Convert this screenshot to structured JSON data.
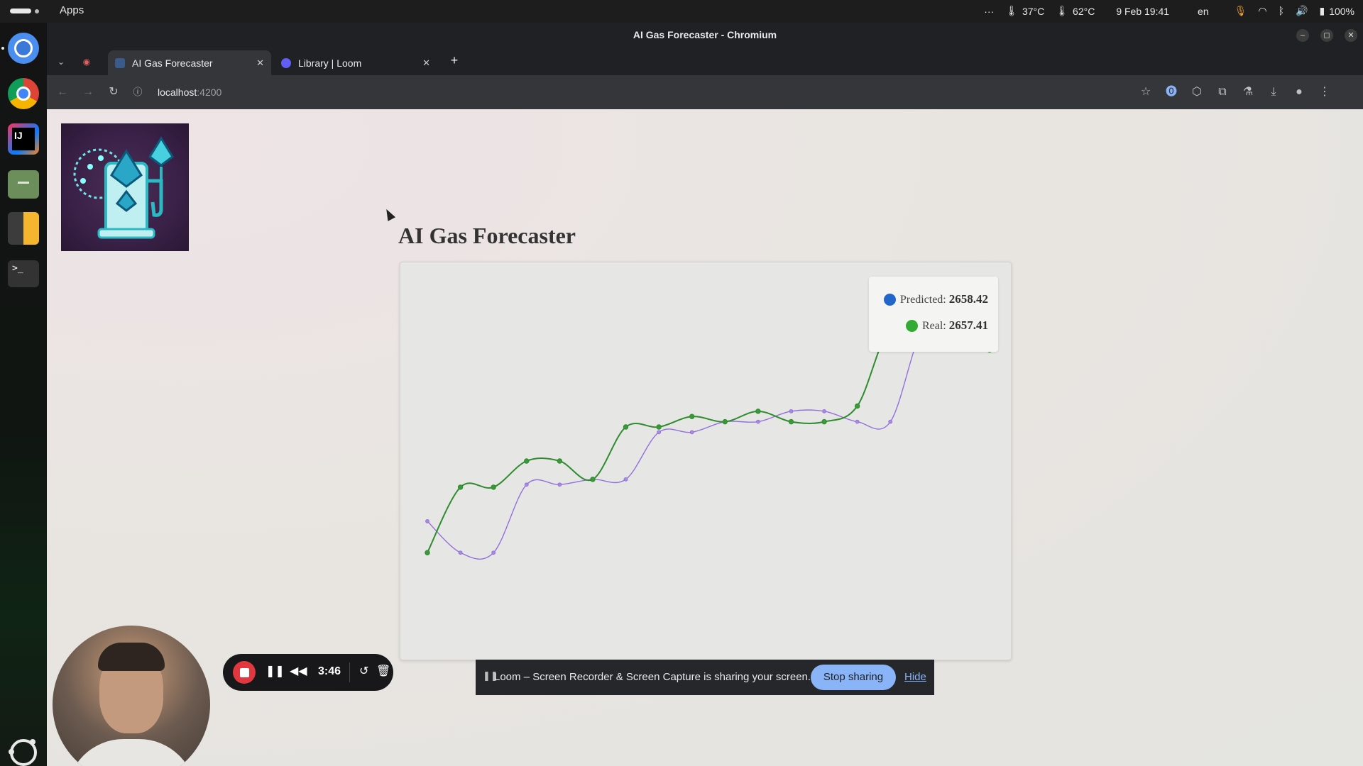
{
  "system_bar": {
    "apps_label": "Apps",
    "overflow": "···",
    "cpu_temp": "37°C",
    "gpu_temp": "62°C",
    "datetime": "9 Feb  19:41",
    "language": "en",
    "battery": "100%"
  },
  "window": {
    "title": "AI Gas Forecaster - Chromium"
  },
  "tabs": [
    {
      "label": "AI Gas Forecaster",
      "active": true
    },
    {
      "label": "Library | Loom",
      "active": false
    }
  ],
  "address_bar": {
    "host": "localhost",
    "port": ":4200"
  },
  "page": {
    "title": "AI Gas Forecaster",
    "tooltip": {
      "predicted_label": "Predicted: ",
      "predicted_value": "2658.42",
      "real_label": "Real: ",
      "real_value": "2657.41"
    }
  },
  "colors": {
    "predicted": "#2266cc",
    "real": "#33aa33",
    "line_real": "#2e8b2e",
    "line_predicted": "#9370db"
  },
  "chart_data": {
    "type": "line",
    "title": "",
    "xlabel": "",
    "ylabel": "",
    "grid": false,
    "legend": "none",
    "x": [
      1,
      2,
      3,
      4,
      5,
      6,
      7,
      8,
      9,
      10,
      11,
      12,
      13,
      14,
      15,
      16,
      17,
      18
    ],
    "ylim": [
      2550,
      2680
    ],
    "series": [
      {
        "name": "Real",
        "values": [
          2580,
          2605,
          2605,
          2615,
          2615,
          2608,
          2628,
          2628,
          2632,
          2630,
          2634,
          2630,
          2630,
          2636,
          2666,
          2661,
          2676,
          2657.41
        ]
      },
      {
        "name": "Predicted",
        "values": [
          2592,
          2580,
          2580,
          2606,
          2606,
          2608,
          2608,
          2626,
          2626,
          2630,
          2630,
          2634,
          2634,
          2630,
          2630,
          2666,
          2666,
          2663
        ]
      }
    ]
  },
  "loom": {
    "timer": "3:46",
    "share_message": "Loom – Screen Recorder & Screen Capture is sharing your screen.",
    "stop_label": "Stop sharing",
    "hide_label": "Hide"
  }
}
